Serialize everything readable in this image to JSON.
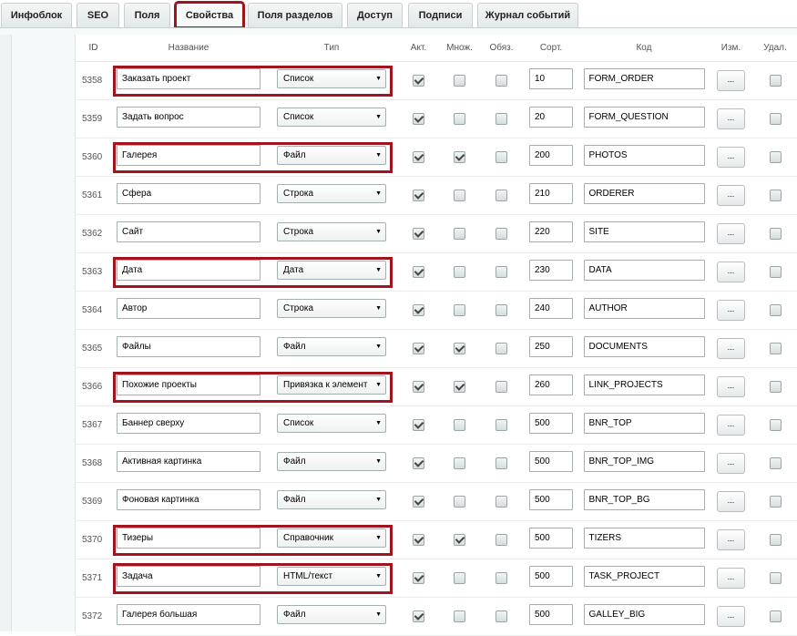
{
  "tabs": [
    {
      "label": "Инфоблок",
      "active": false
    },
    {
      "label": "SEO",
      "active": false
    },
    {
      "label": "Поля",
      "active": false
    },
    {
      "label": "Свойства",
      "active": true
    },
    {
      "label": "Поля разделов",
      "active": false
    },
    {
      "label": "Доступ",
      "active": false
    },
    {
      "label": "Подписи",
      "active": false
    },
    {
      "label": "Журнал событий",
      "active": false
    }
  ],
  "columns": {
    "id": "ID",
    "name": "Название",
    "type": "Тип",
    "active": "Акт.",
    "multiple": "Множ.",
    "required": "Обяз.",
    "sort": "Сорт.",
    "code": "Код",
    "edit": "Изм.",
    "delete": "Удал."
  },
  "edit_button_label": "...",
  "rows": [
    {
      "id": "5358",
      "name": "Заказать проект",
      "type": "Список",
      "active": true,
      "multiple": false,
      "required": false,
      "sort": "10",
      "code": "FORM_ORDER",
      "delete": false,
      "highlighted": true
    },
    {
      "id": "5359",
      "name": "Задать вопрос",
      "type": "Список",
      "active": true,
      "multiple": false,
      "required": false,
      "sort": "20",
      "code": "FORM_QUESTION",
      "delete": false,
      "highlighted": false
    },
    {
      "id": "5360",
      "name": "Галерея",
      "type": "Файл",
      "active": true,
      "multiple": true,
      "required": false,
      "sort": "200",
      "code": "PHOTOS",
      "delete": false,
      "highlighted": true
    },
    {
      "id": "5361",
      "name": "Сфера",
      "type": "Строка",
      "active": true,
      "multiple": false,
      "required": false,
      "sort": "210",
      "code": "ORDERER",
      "delete": false,
      "highlighted": false
    },
    {
      "id": "5362",
      "name": "Сайт",
      "type": "Строка",
      "active": true,
      "multiple": false,
      "required": false,
      "sort": "220",
      "code": "SITE",
      "delete": false,
      "highlighted": false
    },
    {
      "id": "5363",
      "name": "Дата",
      "type": "Дата",
      "active": true,
      "multiple": false,
      "required": false,
      "sort": "230",
      "code": "DATA",
      "delete": false,
      "highlighted": true
    },
    {
      "id": "5364",
      "name": "Автор",
      "type": "Строка",
      "active": true,
      "multiple": false,
      "required": false,
      "sort": "240",
      "code": "AUTHOR",
      "delete": false,
      "highlighted": false
    },
    {
      "id": "5365",
      "name": "Файлы",
      "type": "Файл",
      "active": true,
      "multiple": true,
      "required": false,
      "sort": "250",
      "code": "DOCUMENTS",
      "delete": false,
      "highlighted": false
    },
    {
      "id": "5366",
      "name": "Похожие проекты",
      "type": "Привязка к элемент",
      "active": true,
      "multiple": true,
      "required": false,
      "sort": "260",
      "code": "LINK_PROJECTS",
      "delete": false,
      "highlighted": true
    },
    {
      "id": "5367",
      "name": "Баннер сверху",
      "type": "Список",
      "active": true,
      "multiple": false,
      "required": false,
      "sort": "500",
      "code": "BNR_TOP",
      "delete": false,
      "highlighted": false
    },
    {
      "id": "5368",
      "name": "Активная картинка",
      "type": "Файл",
      "active": true,
      "multiple": false,
      "required": false,
      "sort": "500",
      "code": "BNR_TOP_IMG",
      "delete": false,
      "highlighted": false
    },
    {
      "id": "5369",
      "name": "Фоновая картинка",
      "type": "Файл",
      "active": true,
      "multiple": false,
      "required": false,
      "sort": "500",
      "code": "BNR_TOP_BG",
      "delete": false,
      "highlighted": false
    },
    {
      "id": "5370",
      "name": "Тизеры",
      "type": "Справочник",
      "active": true,
      "multiple": true,
      "required": false,
      "sort": "500",
      "code": "TIZERS",
      "delete": false,
      "highlighted": true
    },
    {
      "id": "5371",
      "name": "Задача",
      "type": "HTML/текст",
      "active": true,
      "multiple": false,
      "required": false,
      "sort": "500",
      "code": "TASK_PROJECT",
      "delete": false,
      "highlighted": true
    },
    {
      "id": "5372",
      "name": "Галерея большая",
      "type": "Файл",
      "active": true,
      "multiple": false,
      "required": false,
      "sort": "500",
      "code": "GALLEY_BIG",
      "delete": false,
      "highlighted": false
    }
  ],
  "colors": {
    "highlight": "#a0141e",
    "content_bg": "#f5f9f9",
    "border": "#a4b0b0"
  }
}
